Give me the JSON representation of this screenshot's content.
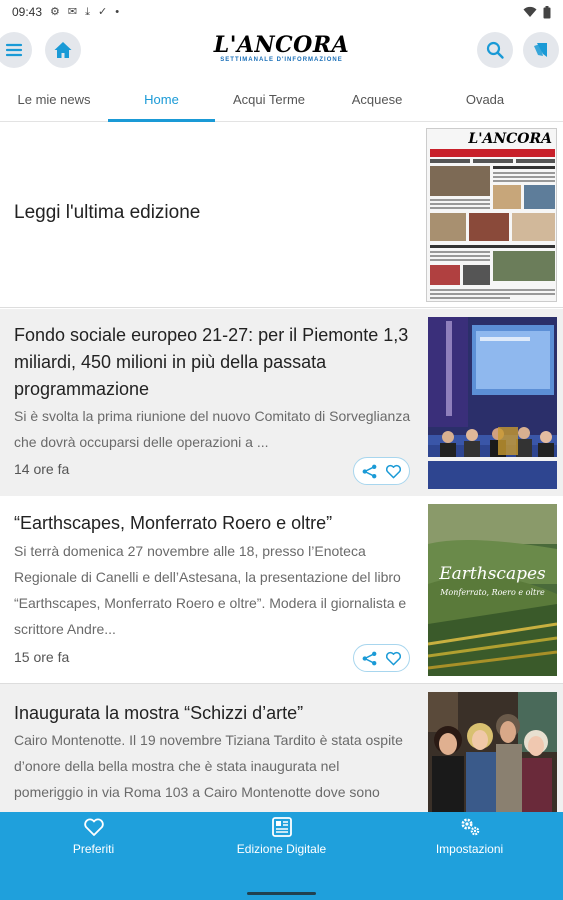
{
  "status_bar": {
    "time": "09:43"
  },
  "header": {
    "logo_text": "L'ANCORA",
    "logo_subtitle": "SETTIMANALE D'INFORMAZIONE",
    "menu_icon": "menu-icon",
    "home_icon": "home-icon",
    "search_icon": "search-icon",
    "shop_icon": "bookmark-icon"
  },
  "tabs": [
    "Le mie news",
    "Home",
    "Acqui Terme",
    "Acquese",
    "Ovada"
  ],
  "active_tab": "Home",
  "edition": {
    "label": "Leggi l'ultima edizione",
    "newspaper_title": "L'ANCORA"
  },
  "articles": [
    {
      "title": "Fondo sociale europeo 21-27: per il Piemonte 1,3 miliardi, 450 milioni in più della passata programmazione",
      "summary": "Si è svolta la prima riunione del nuovo Comitato di Sorveglianza che dovrà occuparsi delle operazioni a ...",
      "time": "14 ore fa"
    },
    {
      "title": "“Earthscapes, Monferrato Roero e oltre”",
      "summary": "Si terrà domenica 27 novembre alle 18, presso l’Enoteca Regionale di Canelli e dell’Astesana, la presentazione del libro “Earthscapes, Monferrato Roero e oltre”. Modera il giornalista e scrittore Andre...",
      "time": "15 ore fa",
      "cover_title": "Earthscapes",
      "cover_subtitle": "Monferrato, Roero e oltre"
    },
    {
      "title": "Inaugurata la mostra “Schizzi d’arte”",
      "summary": "Cairo Montenotte. Il 19 novembre Tiziana Tardito è stata ospite d’onore della bella mostra che è stata inaugurata nel pomeriggio in via Roma 103 a Cairo Montenotte dove sono esposti “Schizzi d’arte”"
    }
  ],
  "bottom_nav": [
    {
      "label": "Preferiti",
      "icon": "heart-icon"
    },
    {
      "label": "Edizione Digitale",
      "icon": "newspaper-icon"
    },
    {
      "label": "Impostazioni",
      "icon": "gears-icon"
    }
  ],
  "colors": {
    "accent": "#1fa0dc",
    "tab_active": "#1a9ad6",
    "card_alt_bg": "#f0f0f0"
  }
}
